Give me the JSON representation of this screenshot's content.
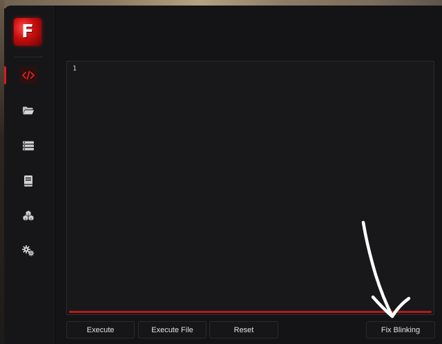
{
  "app": {
    "logo_letter": "F",
    "accent_color": "#d81c1c"
  },
  "sidebar": {
    "items": [
      {
        "icon": "code-icon",
        "active": true
      },
      {
        "icon": "folder-icon",
        "active": false
      },
      {
        "icon": "list-icon",
        "active": false
      },
      {
        "icon": "book-icon",
        "active": false
      },
      {
        "icon": "cubes-icon",
        "active": false
      },
      {
        "icon": "gears-icon",
        "active": false
      }
    ]
  },
  "editor": {
    "line_numbers": [
      "1"
    ],
    "content": ""
  },
  "toolbar": {
    "execute_label": "Execute",
    "execute_file_label": "Execute File",
    "reset_label": "Reset",
    "fix_blinking_label": "Fix Blinking"
  }
}
